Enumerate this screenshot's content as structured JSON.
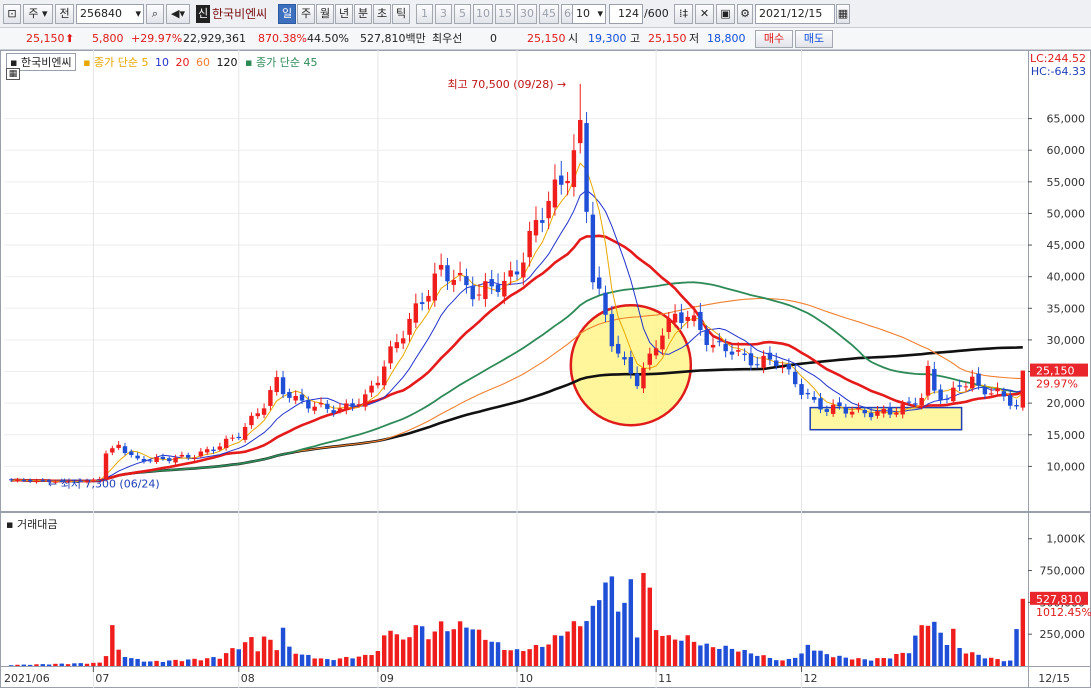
{
  "toolbar": {
    "type_label": "주",
    "prev_label": "전",
    "code": "256840",
    "credit_badge": "신",
    "stock_name": "한국비엔씨",
    "periods": [
      "일",
      "주",
      "월",
      "년",
      "분",
      "초",
      "틱"
    ],
    "active_period": "일",
    "intervals": [
      "1",
      "3",
      "5",
      "10",
      "15",
      "30",
      "45",
      "60"
    ],
    "interval_select": "10",
    "count": "124",
    "count_total": "/600",
    "date": "2021/12/15"
  },
  "quote": {
    "price": "25,150",
    "change": "5,800",
    "change_pct": "+29.97%",
    "volume": "22,929,361",
    "volume_ratio": "870.38%",
    "turnover": "44.50%",
    "amount": "527,810백만",
    "pref_label": "최우선",
    "pref_value": "0",
    "bid": "25,150",
    "open_label": "시",
    "open": "19,300",
    "high_label": "고",
    "high": "25,150",
    "low_label": "저",
    "low": "18,800",
    "buy_label": "매수",
    "sell_label": "매도"
  },
  "legend": {
    "stock": "한국비엔씨",
    "ma_label": "종가 단순",
    "ma_periods": [
      "5",
      "10",
      "20",
      "60",
      "120"
    ],
    "ma2_label": "종가 단순",
    "ma2_period": "45"
  },
  "colors": {
    "up": "#f01d1d",
    "down": "#1f4fd6",
    "ma5": "#e8a800",
    "ma10": "#2233cc",
    "ma20": "#e51a1a",
    "ma45": "#2d8a57",
    "ma60": "#f08030",
    "ma120": "#111111",
    "highlight": "#fff58a"
  },
  "chart_data": [
    {
      "type": "candlestick",
      "title": "",
      "ylim": [
        5000,
        73000
      ],
      "y_ticks": [
        "10,000",
        "15,000",
        "20,000",
        "25,000",
        "30,000",
        "35,000",
        "40,000",
        "45,000",
        "50,000",
        "55,000",
        "60,000",
        "65,000"
      ],
      "x_ticks": [
        "2021/06",
        "07",
        "08",
        "09",
        "10",
        "11",
        "12",
        "12/15"
      ],
      "lc_label": "LC:244.52",
      "hc_label": "HC:-64.33",
      "max_annotation": "최고 70,500 (09/28)",
      "min_annotation": "최저 7,300 (06/24)",
      "last_price_label": "25,150",
      "last_change_label": "29.97%",
      "date_range": [
        "2021/06/14",
        "2021/12/15"
      ],
      "close_anchors": [
        [
          0,
          7800
        ],
        [
          8,
          7600
        ],
        [
          12,
          7700
        ],
        [
          14,
          8100
        ],
        [
          15,
          12000
        ],
        [
          17,
          13500
        ],
        [
          18,
          12200
        ],
        [
          20,
          11200
        ],
        [
          22,
          11000
        ],
        [
          26,
          11300
        ],
        [
          29,
          11700
        ],
        [
          32,
          12800
        ],
        [
          36,
          15000
        ],
        [
          40,
          19800
        ],
        [
          42,
          23500
        ],
        [
          43,
          22000
        ],
        [
          45,
          20500
        ],
        [
          48,
          19500
        ],
        [
          52,
          18900
        ],
        [
          56,
          20800
        ],
        [
          58,
          24000
        ],
        [
          60,
          28000
        ],
        [
          63,
          33000
        ],
        [
          66,
          38000
        ],
        [
          68,
          41000
        ],
        [
          70,
          40000
        ],
        [
          72,
          38500
        ],
        [
          74,
          37000
        ],
        [
          76,
          39000
        ],
        [
          78,
          38500
        ],
        [
          81,
          43000
        ],
        [
          83,
          48500
        ],
        [
          85,
          52000
        ],
        [
          87,
          55000
        ],
        [
          89,
          59000
        ],
        [
          90,
          63000
        ],
        [
          92,
          40000
        ],
        [
          93,
          37000
        ],
        [
          95,
          30000
        ],
        [
          97,
          26000
        ],
        [
          99,
          23500
        ],
        [
          101,
          27000
        ],
        [
          103,
          31500
        ],
        [
          105,
          33500
        ],
        [
          107,
          34000
        ],
        [
          109,
          31500
        ],
        [
          111,
          29000
        ],
        [
          114,
          28500
        ],
        [
          116,
          27000
        ],
        [
          118,
          26500
        ],
        [
          121,
          26800
        ],
        [
          123,
          24500
        ],
        [
          125,
          22000
        ],
        [
          127,
          20000
        ],
        [
          129,
          19000
        ],
        [
          131,
          19300
        ],
        [
          133,
          18700
        ],
        [
          136,
          18400
        ],
        [
          139,
          18600
        ],
        [
          141,
          19300
        ],
        [
          144,
          21000
        ],
        [
          145,
          25000
        ],
        [
          146,
          22000
        ],
        [
          148,
          20500
        ],
        [
          150,
          23000
        ],
        [
          152,
          23600
        ],
        [
          153,
          22300
        ],
        [
          156,
          21600
        ],
        [
          158,
          20300
        ],
        [
          159,
          19400
        ],
        [
          160,
          25150
        ]
      ],
      "annotations": [
        "circle-around-october-bottom",
        "rectangle-around-november-base"
      ]
    },
    {
      "type": "bar",
      "title": "거래대금",
      "ylim": [
        0,
        1100
      ],
      "y_ticks": [
        "250,000",
        "500,000",
        "750,000",
        "1,000K"
      ],
      "last_value_label": "527,810",
      "last_pct_label": "1012.45%",
      "volume_anchors": [
        [
          0,
          8
        ],
        [
          14,
          25
        ],
        [
          15,
          100
        ],
        [
          16,
          310
        ],
        [
          17,
          120
        ],
        [
          19,
          60
        ],
        [
          22,
          35
        ],
        [
          26,
          45
        ],
        [
          30,
          55
        ],
        [
          33,
          70
        ],
        [
          36,
          160
        ],
        [
          38,
          210
        ],
        [
          39,
          140
        ],
        [
          40,
          230
        ],
        [
          42,
          150
        ],
        [
          43,
          300
        ],
        [
          44,
          140
        ],
        [
          46,
          90
        ],
        [
          50,
          50
        ],
        [
          56,
          80
        ],
        [
          58,
          120
        ],
        [
          60,
          320
        ],
        [
          62,
          190
        ],
        [
          64,
          330
        ],
        [
          66,
          240
        ],
        [
          68,
          320
        ],
        [
          70,
          300
        ],
        [
          72,
          340
        ],
        [
          74,
          260
        ],
        [
          76,
          200
        ],
        [
          78,
          140
        ],
        [
          80,
          120
        ],
        [
          83,
          150
        ],
        [
          85,
          180
        ],
        [
          87,
          260
        ],
        [
          89,
          320
        ],
        [
          90,
          340
        ],
        [
          91,
          380
        ],
        [
          92,
          430
        ],
        [
          93,
          560
        ],
        [
          94,
          710
        ],
        [
          95,
          640
        ],
        [
          96,
          460
        ],
        [
          98,
          620
        ],
        [
          99,
          240
        ],
        [
          100,
          800
        ],
        [
          101,
          560
        ],
        [
          102,
          300
        ],
        [
          104,
          220
        ],
        [
          107,
          220
        ],
        [
          110,
          160
        ],
        [
          114,
          140
        ],
        [
          118,
          90
        ],
        [
          122,
          40
        ],
        [
          125,
          90
        ],
        [
          126,
          170
        ],
        [
          128,
          110
        ],
        [
          130,
          80
        ],
        [
          133,
          60
        ],
        [
          136,
          50
        ],
        [
          139,
          70
        ],
        [
          142,
          120
        ],
        [
          144,
          320
        ],
        [
          145,
          380
        ],
        [
          146,
          320
        ],
        [
          148,
          200
        ],
        [
          149,
          270
        ],
        [
          150,
          140
        ],
        [
          152,
          100
        ],
        [
          155,
          60
        ],
        [
          158,
          40
        ],
        [
          160,
          527.81
        ]
      ]
    }
  ]
}
